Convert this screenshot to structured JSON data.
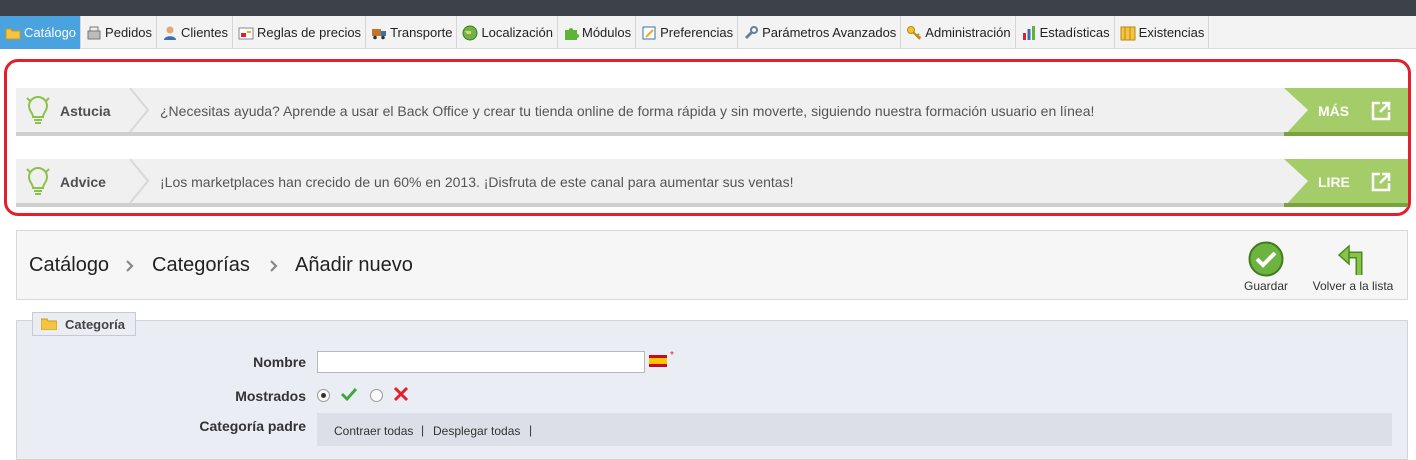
{
  "menu": {
    "items": [
      {
        "label": "Catálogo",
        "icon": "folder-icon",
        "active": true
      },
      {
        "label": "Pedidos",
        "icon": "cash-register-icon"
      },
      {
        "label": "Clientes",
        "icon": "user-icon"
      },
      {
        "label": "Reglas de precios",
        "icon": "price-tag-icon"
      },
      {
        "label": "Transporte",
        "icon": "truck-icon"
      },
      {
        "label": "Localización",
        "icon": "globe-icon"
      },
      {
        "label": "Módulos",
        "icon": "puzzle-icon"
      },
      {
        "label": "Preferencias",
        "icon": "preferences-icon"
      },
      {
        "label": "Parámetros Avanzados",
        "icon": "wrench-icon"
      },
      {
        "label": "Administración",
        "icon": "key-icon"
      },
      {
        "label": "Estadísticas",
        "icon": "bar-chart-icon"
      },
      {
        "label": "Existencias",
        "icon": "stock-icon"
      }
    ]
  },
  "tips": [
    {
      "kind": "Astucia",
      "message": "¿Necesitas ayuda? Aprende a usar el Back Office y crear tu tienda online de forma rápida y sin moverte, siguiendo nuestra formación usuario en línea!",
      "action": "MÁS"
    },
    {
      "kind": "Advice",
      "message": "¡Los marketplaces han crecido de un 60% en 2013. ¡Disfruta de este canal para aumentar sus ventas!",
      "action": "LIRE"
    }
  ],
  "breadcrumb": [
    "Catálogo",
    "Categorías",
    "Añadir nuevo"
  ],
  "toolbar": {
    "save_label": "Guardar",
    "back_label": "Volver a la lista"
  },
  "form": {
    "legend": "Categoría",
    "name_label": "Nombre",
    "name_value": "",
    "required_mark": "*",
    "shown_label": "Mostrados",
    "shown_value": "yes",
    "parent_label": "Categoría padre",
    "collapse_all": "Contraer todas",
    "expand_all": "Desplegar todas",
    "separator": "|"
  },
  "colors": {
    "accent_green": "#8bc34a",
    "active_tab": "#4aa3df",
    "highlight": "#e2202c"
  }
}
